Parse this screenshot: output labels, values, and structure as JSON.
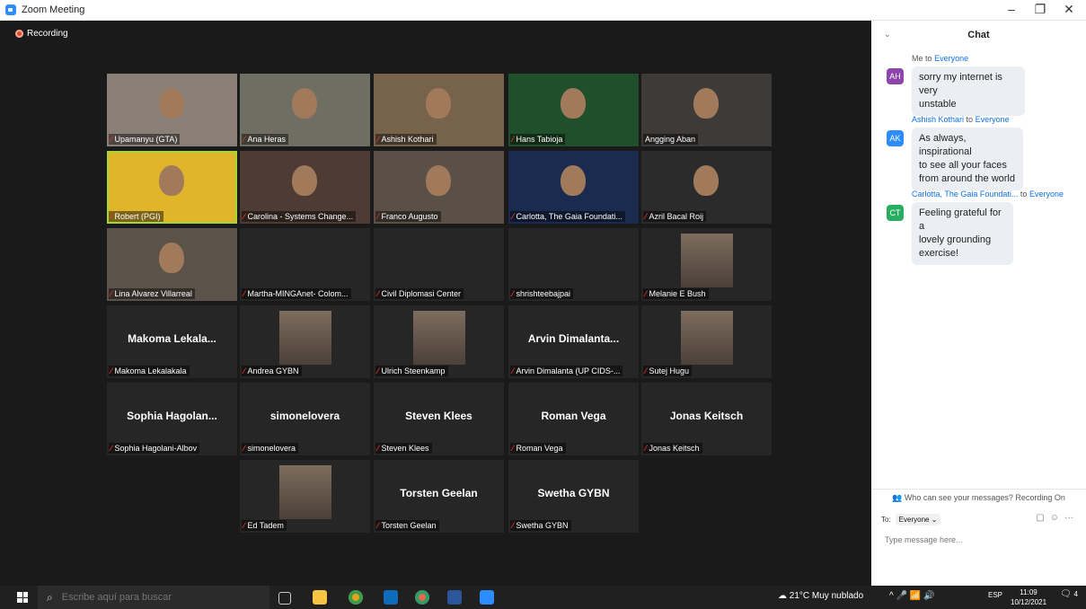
{
  "window": {
    "title": "Zoom Meeting",
    "min_glyph": "–",
    "max_glyph": "❐",
    "close_glyph": "✕"
  },
  "recording": {
    "label": "Recording"
  },
  "participants": [
    {
      "label": "Upamanyu (GTA)",
      "display": "",
      "video": true,
      "muted": true
    },
    {
      "label": "Ana Heras",
      "display": "",
      "video": true,
      "muted": true
    },
    {
      "label": "Ashish Kothari",
      "display": "",
      "video": true,
      "muted": true
    },
    {
      "label": "Hans Tabioja",
      "display": "",
      "video": true,
      "muted": true
    },
    {
      "label": "Angging Aban",
      "display": "",
      "video": true,
      "muted": false
    },
    {
      "label": "Robert (PGI)",
      "display": "",
      "video": true,
      "muted": true,
      "active": true
    },
    {
      "label": "Carolina - Systems Change...",
      "display": "",
      "video": true,
      "muted": true
    },
    {
      "label": "Franco Augusto",
      "display": "",
      "video": true,
      "muted": true
    },
    {
      "label": "Carlotta, The Gaia Foundati...",
      "display": "",
      "video": true,
      "muted": true
    },
    {
      "label": "Azril Bacal Roij",
      "display": "",
      "video": true,
      "muted": true
    },
    {
      "label": "Lina Alvarez Villarreal",
      "display": "",
      "video": true,
      "muted": true
    },
    {
      "label": "Martha-MINGAnet- Colom...",
      "display": "",
      "video": false,
      "muted": true
    },
    {
      "label": "Civil Diplomasi Center",
      "display": "",
      "video": false,
      "muted": true
    },
    {
      "label": "shrishteebajpai",
      "display": "",
      "video": false,
      "muted": true
    },
    {
      "label": "Melanie E Bush",
      "display": "",
      "video": false,
      "photo": true,
      "muted": true
    },
    {
      "label": "Makoma Lekalakala",
      "display": "Makoma  Lekala...",
      "video": false,
      "muted": true
    },
    {
      "label": "Andrea GYBN",
      "display": "",
      "video": false,
      "photo": true,
      "muted": true
    },
    {
      "label": "Ulrich Steenkamp",
      "display": "",
      "video": false,
      "photo": true,
      "muted": true
    },
    {
      "label": "Arvin Dimalanta (UP CIDS-...",
      "display": "Arvin  Dimalanta...",
      "video": false,
      "muted": true
    },
    {
      "label": "Sutej Hugu",
      "display": "",
      "video": false,
      "photo": true,
      "muted": true
    },
    {
      "label": "Sophia Hagolani-Albov",
      "display": "Sophia  Hagolan...",
      "video": false,
      "muted": true
    },
    {
      "label": "simonelovera",
      "display": "simonelovera",
      "video": false,
      "muted": true
    },
    {
      "label": "Steven Klees",
      "display": "Steven Klees",
      "video": false,
      "muted": true
    },
    {
      "label": "Roman Vega",
      "display": "Roman Vega",
      "video": false,
      "muted": true
    },
    {
      "label": "Jonas Keitsch",
      "display": "Jonas Keitsch",
      "video": false,
      "muted": true
    },
    {
      "label": "Ed Tadem",
      "display": "",
      "video": false,
      "photo": true,
      "muted": true
    },
    {
      "label": "Torsten Geelan",
      "display": "Torsten Geelan",
      "video": false,
      "muted": true
    },
    {
      "label": "Swetha GYBN",
      "display": "Swetha GYBN",
      "video": false,
      "muted": true
    }
  ],
  "chat": {
    "title": "Chat",
    "messages": [
      {
        "sender": "Me",
        "to_word": "to",
        "recipient": "Everyone",
        "initials": "AH",
        "avatar_color": "#8e44ad",
        "text_lines": [
          "sorry my internet is very",
          "unstable"
        ]
      },
      {
        "sender": "Ashish Kothari",
        "to_word": "to",
        "recipient": "Everyone",
        "initials": "AK",
        "avatar_color": "#2d8cff",
        "text_lines": [
          "As always, inspirational",
          "to see all your faces",
          "from around the world"
        ]
      },
      {
        "sender": "Carlotta, The Gaia Foundati...",
        "to_word": "to",
        "recipient": "Everyone",
        "initials": "CT",
        "avatar_color": "#27ae60",
        "text_lines": [
          "Feeling grateful for a",
          "lovely grounding",
          "exercise!"
        ]
      }
    ],
    "privacy_note": "Who can see your messages? Recording On",
    "to_label": "To:",
    "to_value": "Everyone",
    "input_placeholder": "Type message here..."
  },
  "taskbar": {
    "search_placeholder": "Escribe aquí para buscar",
    "weather": "21°C  Muy nublado",
    "language": "ESP",
    "time": "11:09",
    "date": "10/12/2021",
    "notifications": "4"
  }
}
